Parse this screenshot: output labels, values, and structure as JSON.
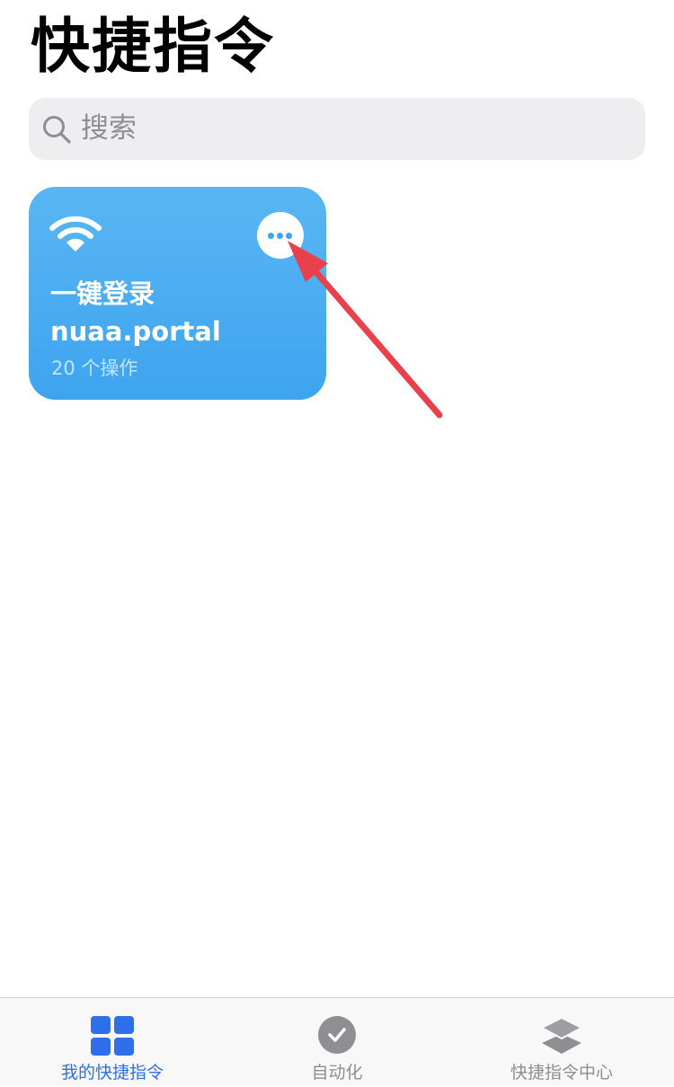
{
  "header": {
    "title": "快捷指令"
  },
  "search": {
    "placeholder": "搜索",
    "icon": "search-icon"
  },
  "shortcuts": [
    {
      "title": "一键登录\nnuaa.portal",
      "action_count": "20 个操作",
      "icon": "wifi-icon",
      "color": "#4aacf1",
      "more_icon": "more-icon"
    }
  ],
  "tabs": [
    {
      "label": "我的快捷指令",
      "icon": "grid-icon",
      "active": true
    },
    {
      "label": "自动化",
      "icon": "automation-check-icon",
      "active": false
    },
    {
      "label": "快捷指令中心",
      "icon": "layers-icon",
      "active": false
    }
  ],
  "colors": {
    "accent": "#2f6fea",
    "annotation": "#e8414b",
    "inactive": "#8e8e93"
  }
}
